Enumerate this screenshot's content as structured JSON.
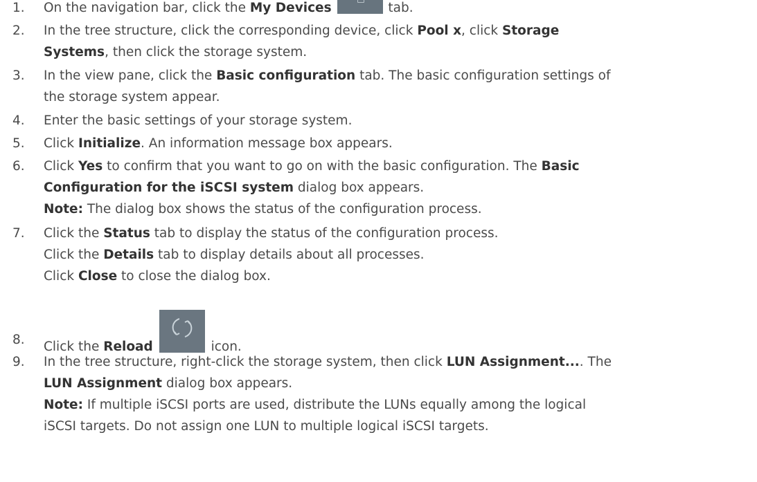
{
  "steps": [
    {
      "num": "1.",
      "s1": "On the navigation bar, click the ",
      "b1": "My Devices",
      "s2": " tab.",
      "icon": "my-devices-icon"
    },
    {
      "num": "2.",
      "s1": "In the tree structure, click the corresponding device, click ",
      "b1": "Pool x",
      "s2": ", click ",
      "b2": "Storage",
      "b3": "Systems",
      "s3": ", then click the storage system."
    },
    {
      "num": "3.",
      "s1": "In the view pane, click the ",
      "b1": "Basic configuration",
      "s2": " tab. The basic configuration settings of",
      "s3": "the storage system appear."
    },
    {
      "num": "4.",
      "s1": "Enter the basic settings of your storage system."
    },
    {
      "num": "5.",
      "s1": "Click ",
      "b1": "Initialize",
      "s2": ". An information message box appears."
    },
    {
      "num": "6.",
      "s1": "Click ",
      "b1": "Yes",
      "s2": " to confirm that you want to go on with the basic configuration. The ",
      "b2": "Basic",
      "b3": "Configuration for the iSCSI system",
      "s3": " dialog box appears.",
      "note_label": "Note:",
      "note": " The dialog box shows the status of the configuration process."
    },
    {
      "num": "7.",
      "s1": "Click the ",
      "b1": "Status",
      "s2": " tab to display the status of the configuration process.",
      "s3": "Click the ",
      "b2": "Details",
      "s4": " tab to display details about all processes.",
      "s5": "Click ",
      "b3": "Close",
      "s6": " to close the dialog box."
    },
    {
      "num": "8.",
      "s1": "Click the ",
      "b1": "Reload",
      "s2": " icon.",
      "icon": "reload-icon"
    },
    {
      "num": "9.",
      "s1": "In the tree structure, right-click the storage system, then click ",
      "b1": "LUN Assignment...",
      "s2": ". The",
      "b2": "LUN Assignment",
      "s3": " dialog box appears.",
      "note_label": "Note:",
      "note1": " If multiple iSCSI ports are used, distribute the LUNs equally among the logical",
      "note2": "iSCSI targets. Do not assign one LUN to multiple logical iSCSI targets."
    }
  ]
}
